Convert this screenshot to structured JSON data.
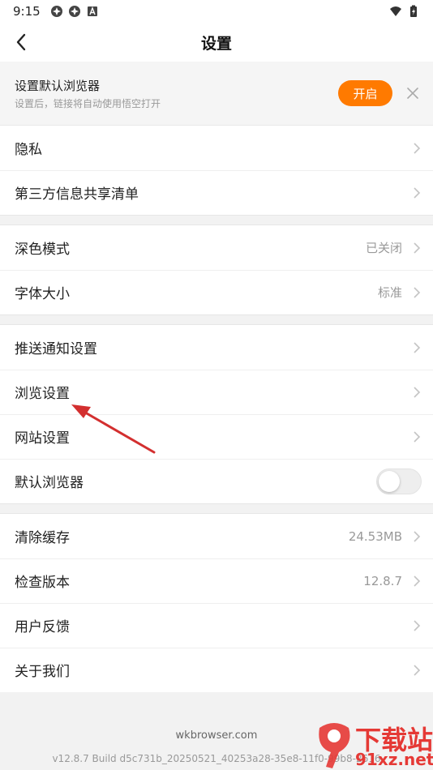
{
  "status_bar": {
    "time": "9:15",
    "left_icons": [
      "app-icon-1",
      "app-icon-2",
      "font-icon"
    ],
    "right_icons": [
      "wifi-icon",
      "battery-icon"
    ]
  },
  "header": {
    "title": "设置",
    "back_icon": "chevron-left-icon"
  },
  "banner": {
    "title": "设置默认浏览器",
    "subtitle": "设置后，链接将自动使用悟空打开",
    "button_label": "开启",
    "close_icon": "close-icon",
    "accent_color": "#ff7a00"
  },
  "groups": [
    {
      "items": [
        {
          "label": "隐私",
          "value": ""
        },
        {
          "label": "第三方信息共享清单",
          "value": ""
        }
      ]
    },
    {
      "items": [
        {
          "label": "深色模式",
          "value": "已关闭"
        },
        {
          "label": "字体大小",
          "value": "标准"
        }
      ]
    },
    {
      "items": [
        {
          "label": "推送通知设置",
          "value": ""
        },
        {
          "label": "浏览设置",
          "value": ""
        },
        {
          "label": "网站设置",
          "value": ""
        },
        {
          "label": "默认浏览器",
          "value": "",
          "toggle": false
        }
      ]
    },
    {
      "items": [
        {
          "label": "清除缓存",
          "value": "24.53MB"
        },
        {
          "label": "检查版本",
          "value": "12.8.7"
        },
        {
          "label": "用户反馈",
          "value": ""
        },
        {
          "label": "关于我们",
          "value": ""
        }
      ]
    }
  ],
  "footer": {
    "site": "wkbrowser.com",
    "build": "v12.8.7 Build d5c731b_20250521_40253a28-35e8-11f0-99b8-2616"
  },
  "watermark": {
    "main": "下载站",
    "sub": "91xz.net",
    "color": "#e53935"
  },
  "annotation": {
    "arrow_color": "#d32f2f"
  }
}
